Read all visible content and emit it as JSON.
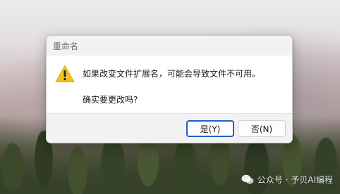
{
  "dialog": {
    "title": "重命名",
    "icon": "warning-icon",
    "message_line1": "如果改变文件扩展名，可能会导致文件不可用。",
    "message_line2": "确实要更改吗?",
    "yes_label": "是(Y)",
    "no_label": "否(N)"
  },
  "watermark": {
    "icon": "wechat-icon",
    "text": "公众号 · 予贝AI编程"
  },
  "colors": {
    "warning_yellow": "#f5c21b",
    "default_button_border": "#1f5fbf",
    "titlebar_bg": "#f2f2f2",
    "footer_bg": "#f2f2f2"
  }
}
